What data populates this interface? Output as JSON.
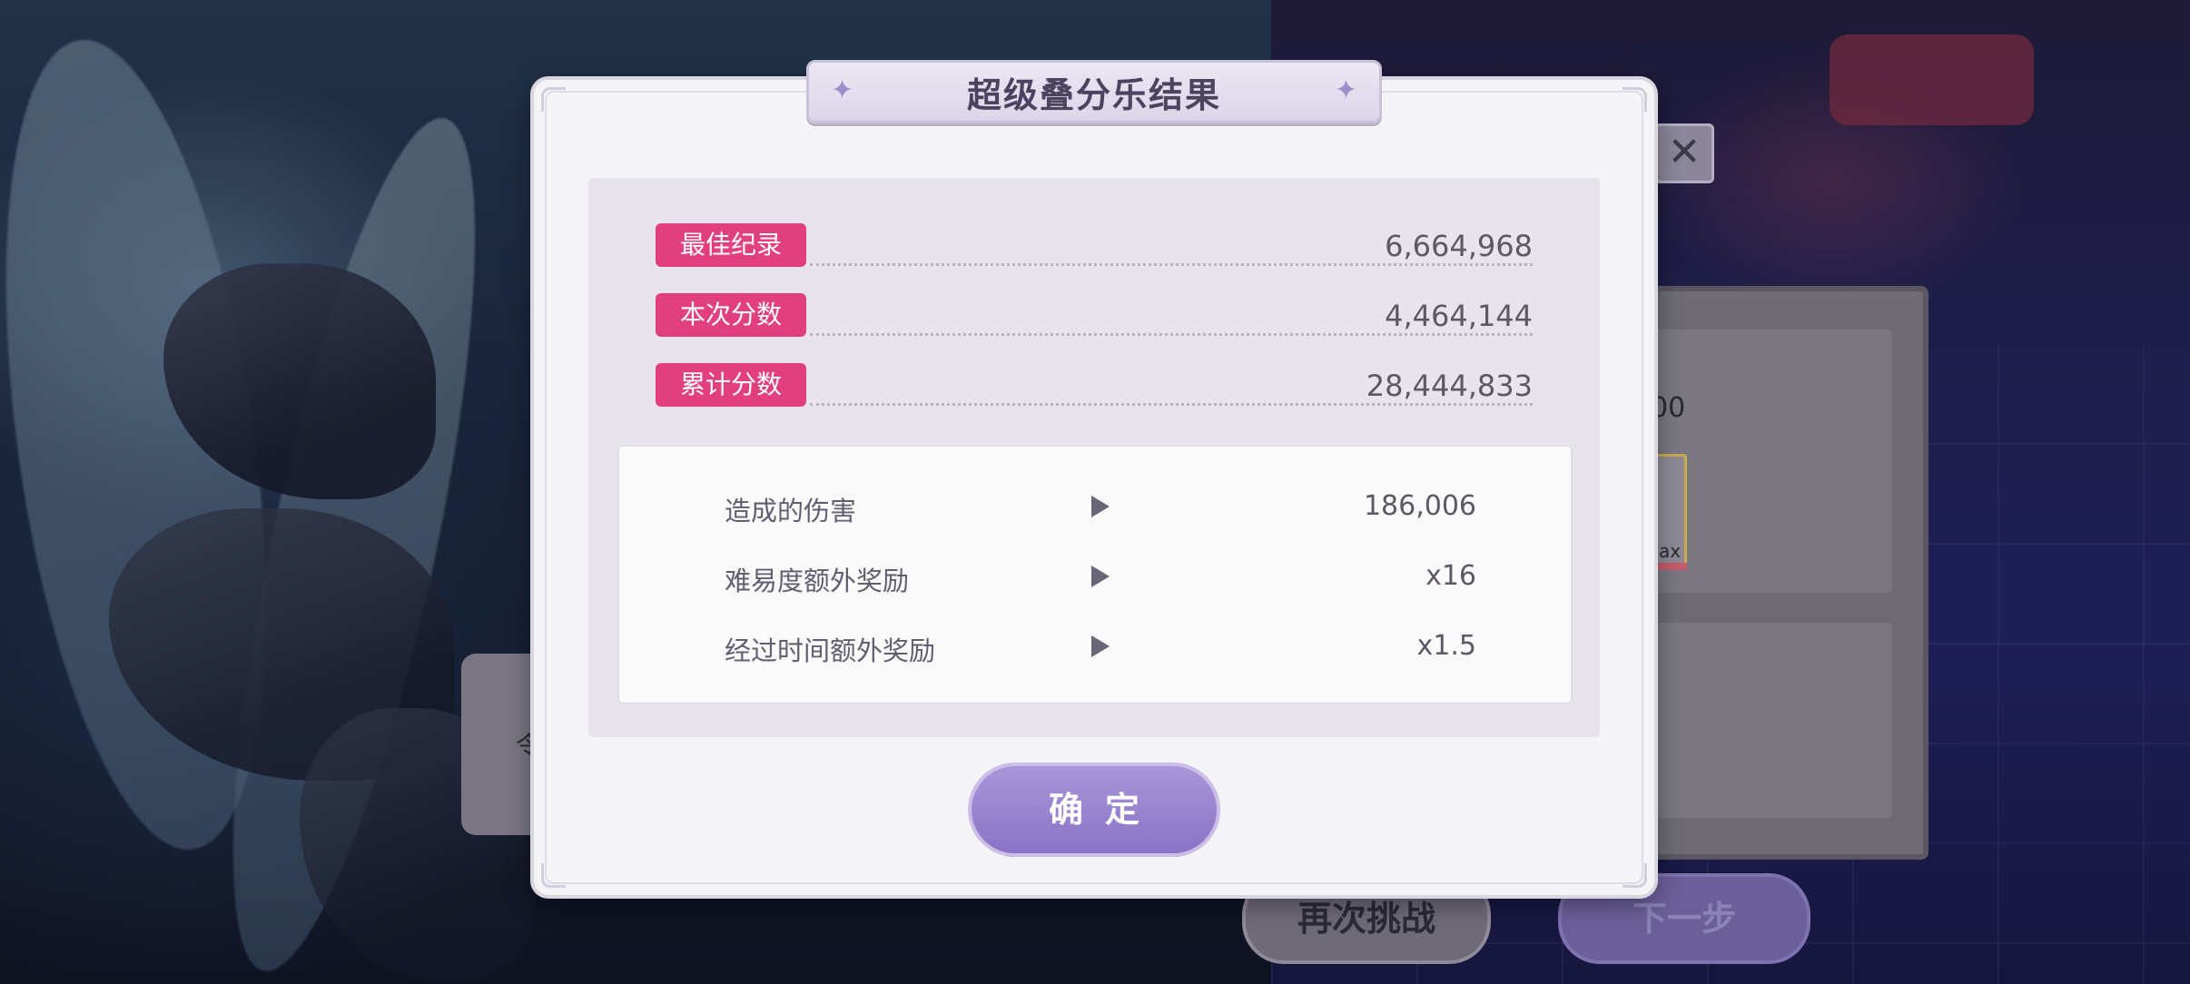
{
  "dialog": {
    "title": "超级叠分乐结果",
    "scores": [
      {
        "label": "最佳纪录",
        "value": "6,664,968"
      },
      {
        "label": "本次分数",
        "value": "4,464,144"
      },
      {
        "label": "累计分数",
        "value": "28,444,833"
      }
    ],
    "breakdown": [
      {
        "label": "造成的伤害",
        "value": "186,006"
      },
      {
        "label": "难易度额外奖励",
        "value": "x16"
      },
      {
        "label": "经过时间额外奖励",
        "value": "x1.5"
      }
    ],
    "confirm_label": "确定"
  },
  "background": {
    "retry_label": "再次挑战",
    "next_label": "下一步",
    "close_glyph": "✕",
    "panel_fragment_top": "00",
    "panel_fragment_card": "ax",
    "left_fragment": "令"
  },
  "icons": {
    "close": "close-icon",
    "sparkle": "sparkle-icon",
    "arrow": "play-arrow-icon"
  },
  "colors": {
    "score_label_bg": "#e23f7f",
    "confirm_button": "#9a86d0",
    "dialog_bg": "#f4f3f6"
  }
}
